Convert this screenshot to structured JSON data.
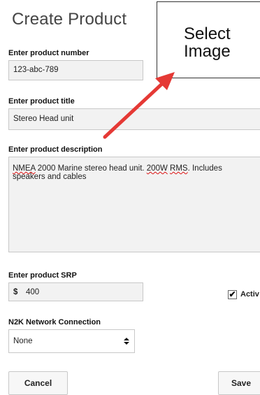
{
  "page": {
    "title": "Create Product"
  },
  "image_box": {
    "label": "Select Image"
  },
  "product_number": {
    "label": "Enter product number",
    "value": "123-abc-789"
  },
  "product_title": {
    "label": "Enter product title",
    "value": "Stereo Head unit"
  },
  "product_description": {
    "label": "Enter product description",
    "parts": [
      "NMEA",
      " 2000 Marine stereo head  unit. ",
      "200W",
      " ",
      "RMS",
      ". Includes speakers and cables"
    ]
  },
  "product_srp": {
    "label": "Enter product SRP",
    "currency": "$",
    "value": "400"
  },
  "active": {
    "label": "Activ",
    "checked": true,
    "check_glyph": "✔"
  },
  "n2k": {
    "label": "N2K Network Connection",
    "selected": "None"
  },
  "buttons": {
    "cancel": "Cancel",
    "save": "Save"
  },
  "colors": {
    "arrow": "#e53935",
    "field_bg": "#f2f2f2"
  }
}
